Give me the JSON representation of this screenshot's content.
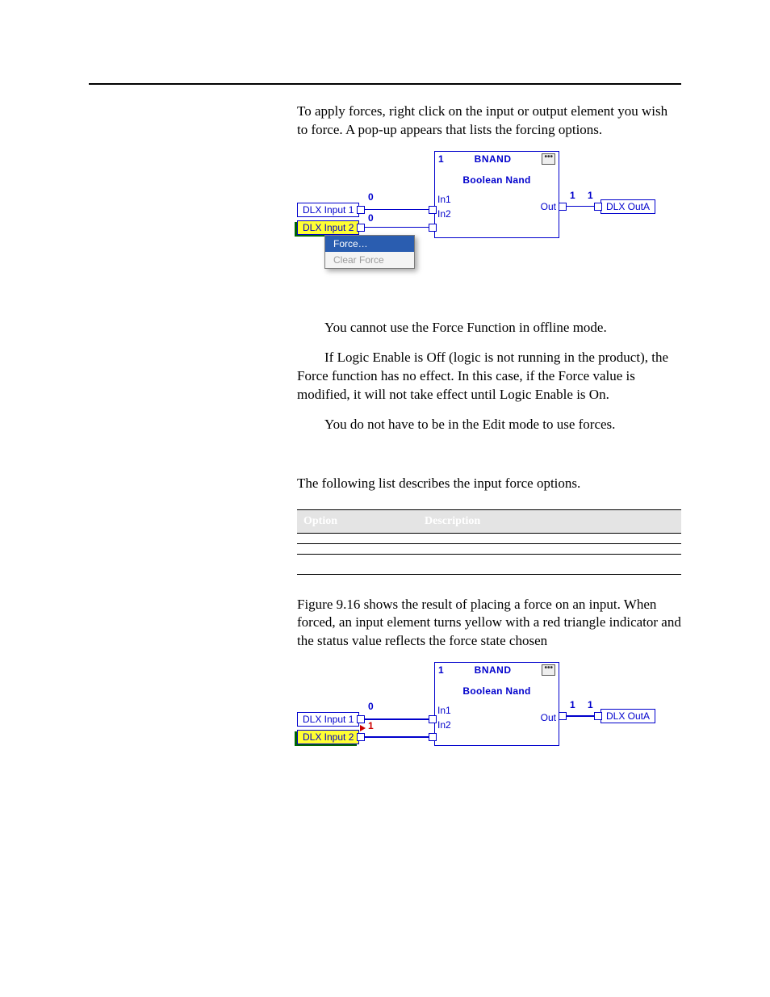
{
  "body": {
    "intro": "To apply forces, right click on the input or output element you wish to force.  A pop-up appears that lists the forcing options.",
    "note1": "You cannot use the Force Function in offline mode.",
    "note2a": "If Logic Enable is Off (logic is not running in the product), the Force function has no effect.  In this case, if the Force value is modified, it will not take effect until Logic Enable is On.",
    "note2a_indent": "If Logic Enable is Off (logic is not running in the product), the",
    "note2a_rest": "Force function has no effect.  In this case, if the Force value is modified, it will not take effect until Logic Enable is On.",
    "note3": "You do not have to be in the Edit mode to use forces.",
    "list_intro": "The following list describes the input force options.",
    "fig_text": "Figure 9.16 shows the result of placing a force on an input.  When forced, an input element turns yellow with a red triangle indicator and the status value reflects the force state chosen"
  },
  "diagram": {
    "gate_id": "1",
    "gate_name": "BNAND",
    "gate_sub": "Boolean Nand",
    "in1": "In1",
    "in2": "In2",
    "out": "Out",
    "inp1": "DLX Input 1",
    "inp2": "DLX Input 2",
    "outA": "DLX OutA",
    "val0": "0",
    "val1": "1",
    "forced": "1"
  },
  "popup": {
    "force": "Force…",
    "clear": "Clear Force"
  },
  "table": {
    "h1": "Option",
    "h2": "Description",
    "r1c1": "",
    "r1c2": "",
    "r2c1": "",
    "r2c2": "",
    "r3c1": "",
    "r3c2": ""
  }
}
